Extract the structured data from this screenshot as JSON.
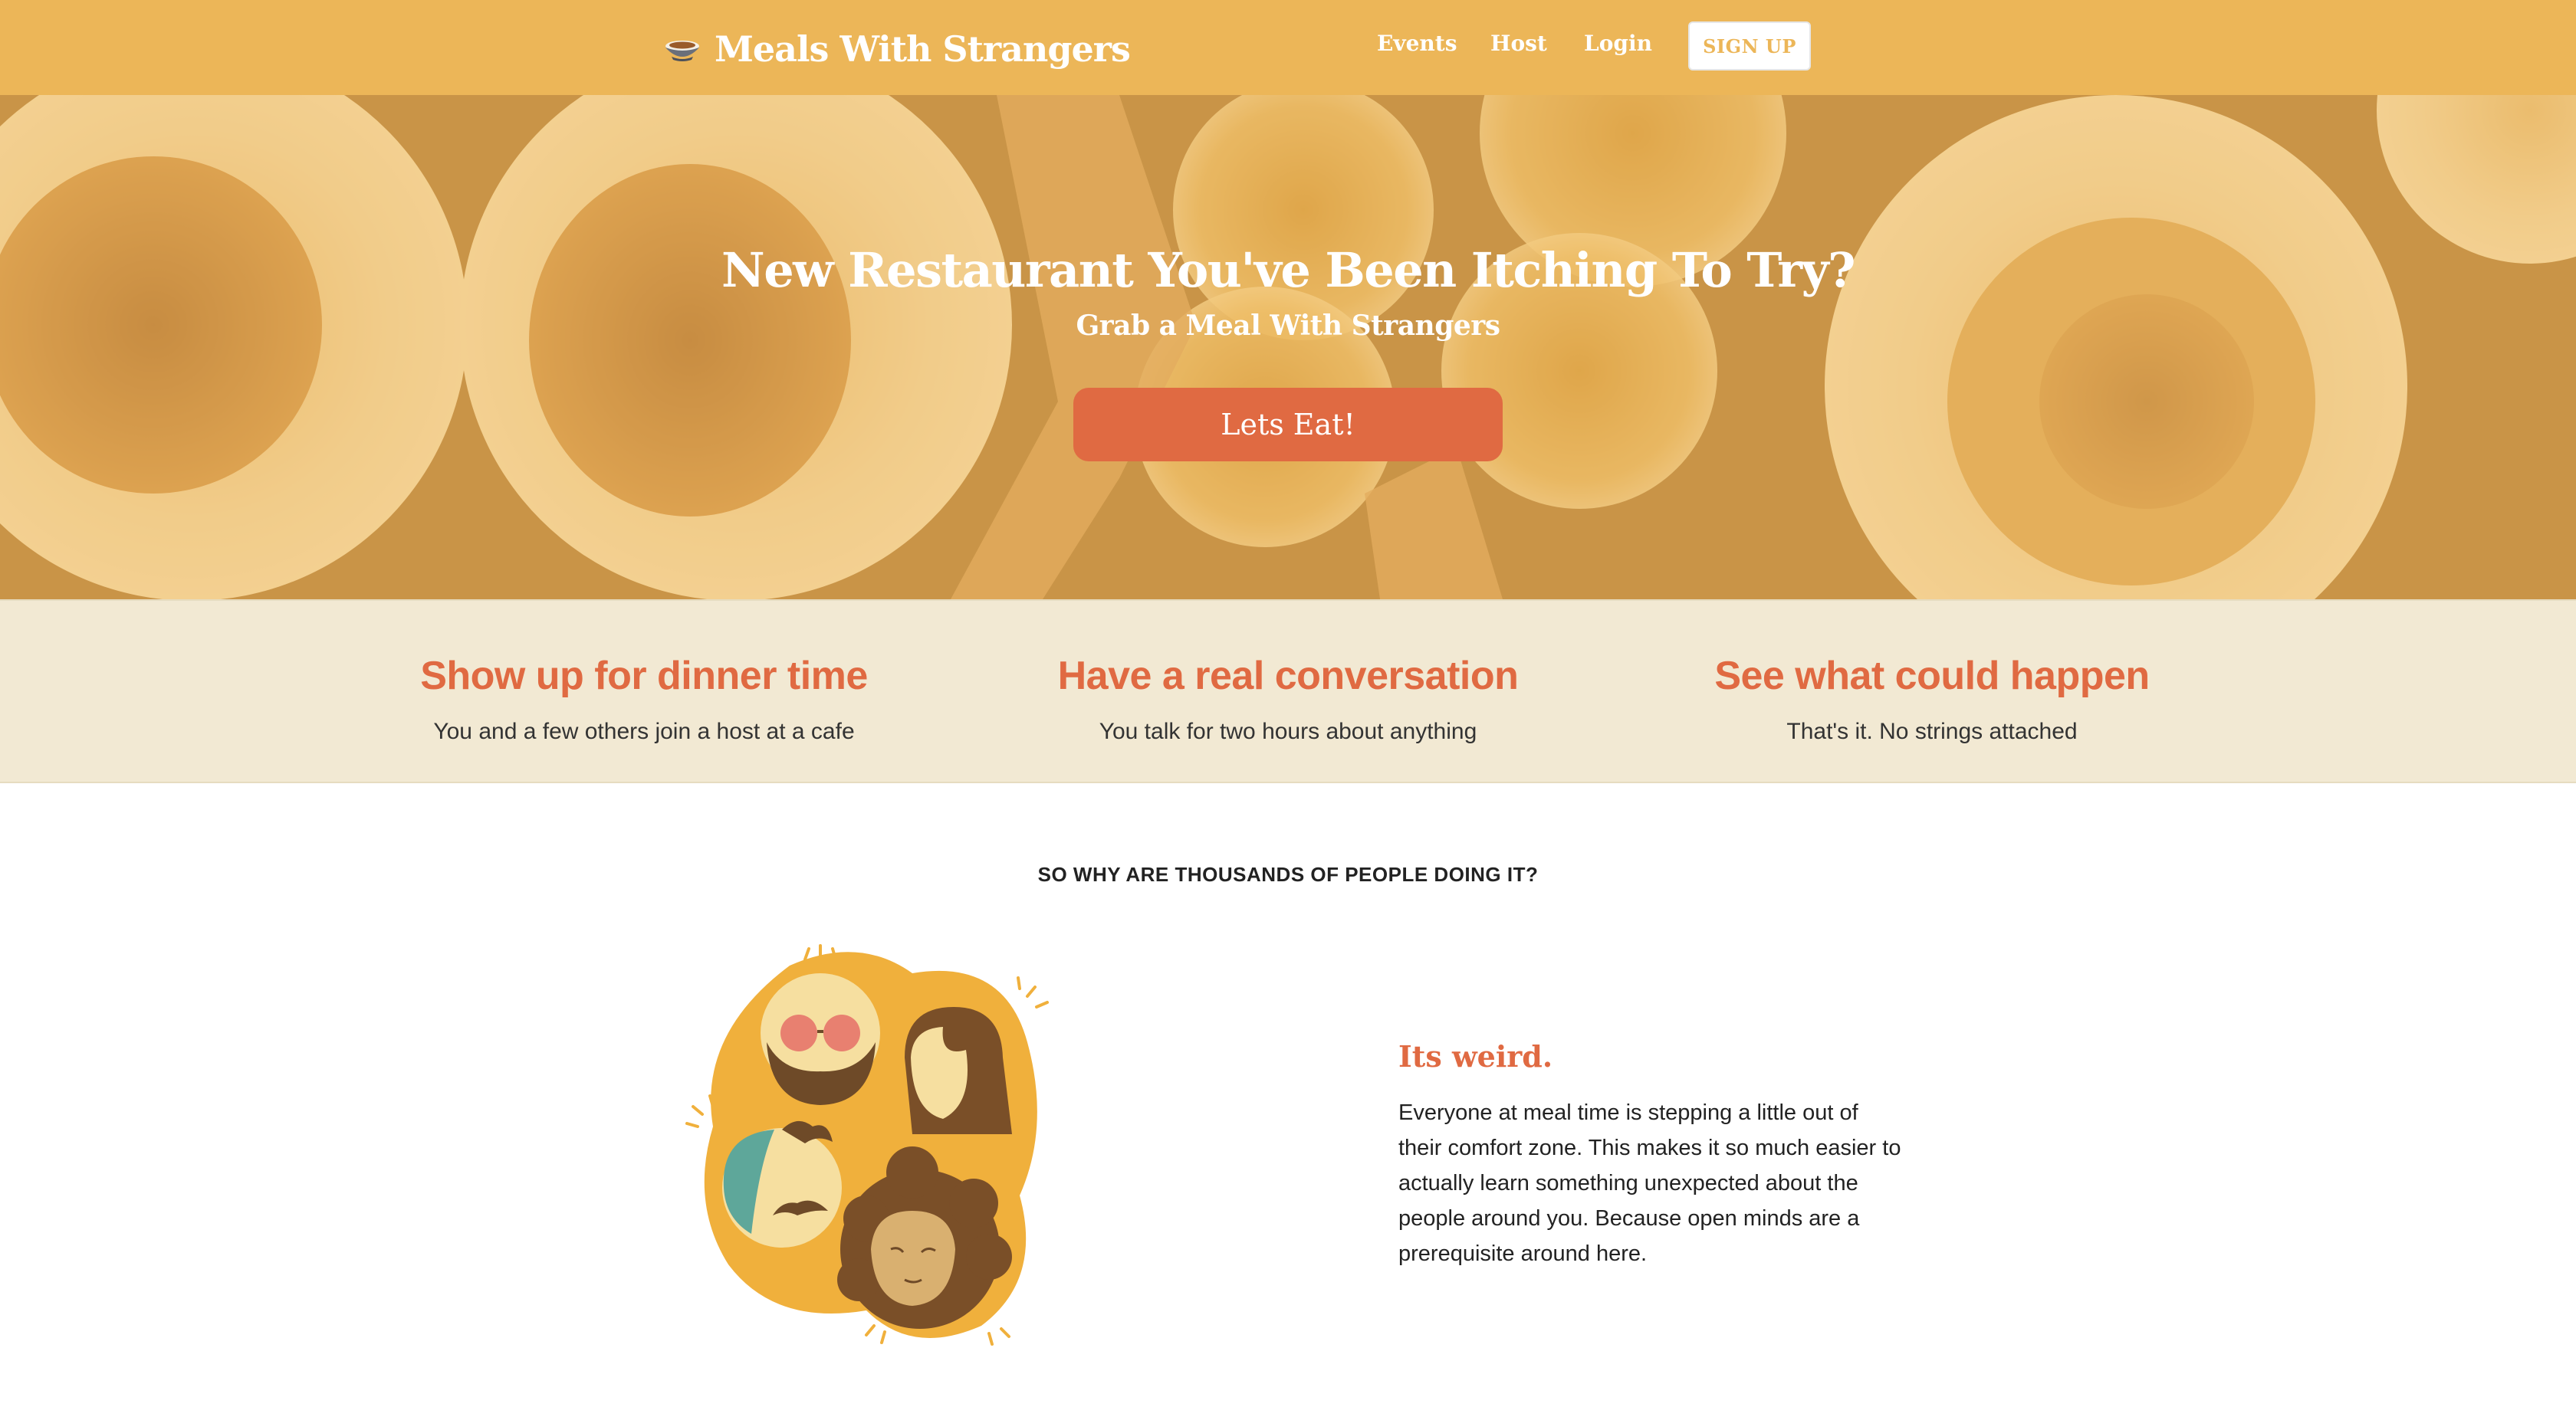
{
  "nav": {
    "brand": "Meals With Strangers",
    "brand_icon": "bowl-icon",
    "links": [
      "Events",
      "Host",
      "Login"
    ],
    "signup": "SIGN UP"
  },
  "hero": {
    "title": "New Restaurant You've Been Itching To Try?",
    "subtitle": "Grab a Meal With Strangers",
    "button": "Lets Eat!"
  },
  "features": [
    {
      "title": "Show up for dinner time",
      "text": "You and a few others join a host at a cafe"
    },
    {
      "title": "Have a real conversation",
      "text": "You talk for two hours about anything"
    },
    {
      "title": "See what could happen",
      "text": "That's it. No strings attached"
    }
  ],
  "why": {
    "heading": "SO WHY ARE THOUSANDS OF PEOPLE DOING IT?",
    "title": "Its weird.",
    "body": "Everyone at meal time is stepping a little out of their comfort zone. This makes it so much easier to actually learn something unexpected about the people around you. Because open minds are a prerequisite around here."
  },
  "colors": {
    "nav_bg": "#ecb658",
    "accent": "#e06a42",
    "features_bg": "#f2e9d3"
  }
}
